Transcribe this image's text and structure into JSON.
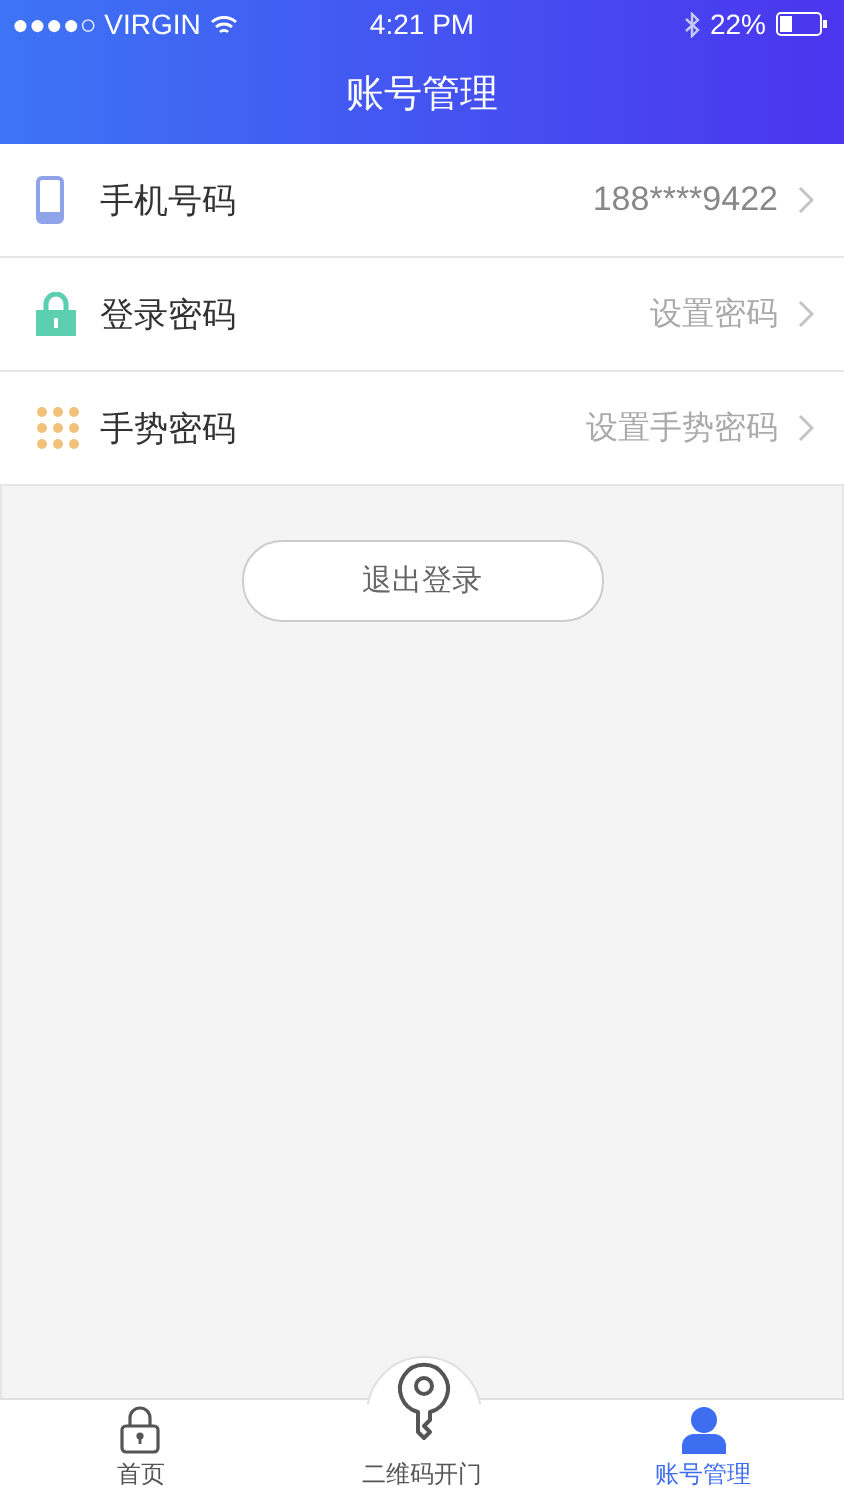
{
  "status_bar": {
    "carrier": "●●●●○ VIRGIN",
    "time": "4:21 PM",
    "battery": "22%"
  },
  "nav": {
    "title": "账号管理"
  },
  "settings": [
    {
      "kind": "phone",
      "label": "手机号码",
      "value": "188****9422"
    },
    {
      "kind": "lock",
      "label": "登录密码",
      "value": "设置密码"
    },
    {
      "kind": "gesture",
      "label": "手势密码",
      "value": "设置手势密码"
    }
  ],
  "logout_button": "退出登录",
  "tabs": [
    {
      "kind": "home",
      "label": "首页",
      "selected": false
    },
    {
      "kind": "key",
      "label": "二维码开门",
      "selected": false
    },
    {
      "kind": "account",
      "label": "账号管理",
      "selected": true
    }
  ]
}
